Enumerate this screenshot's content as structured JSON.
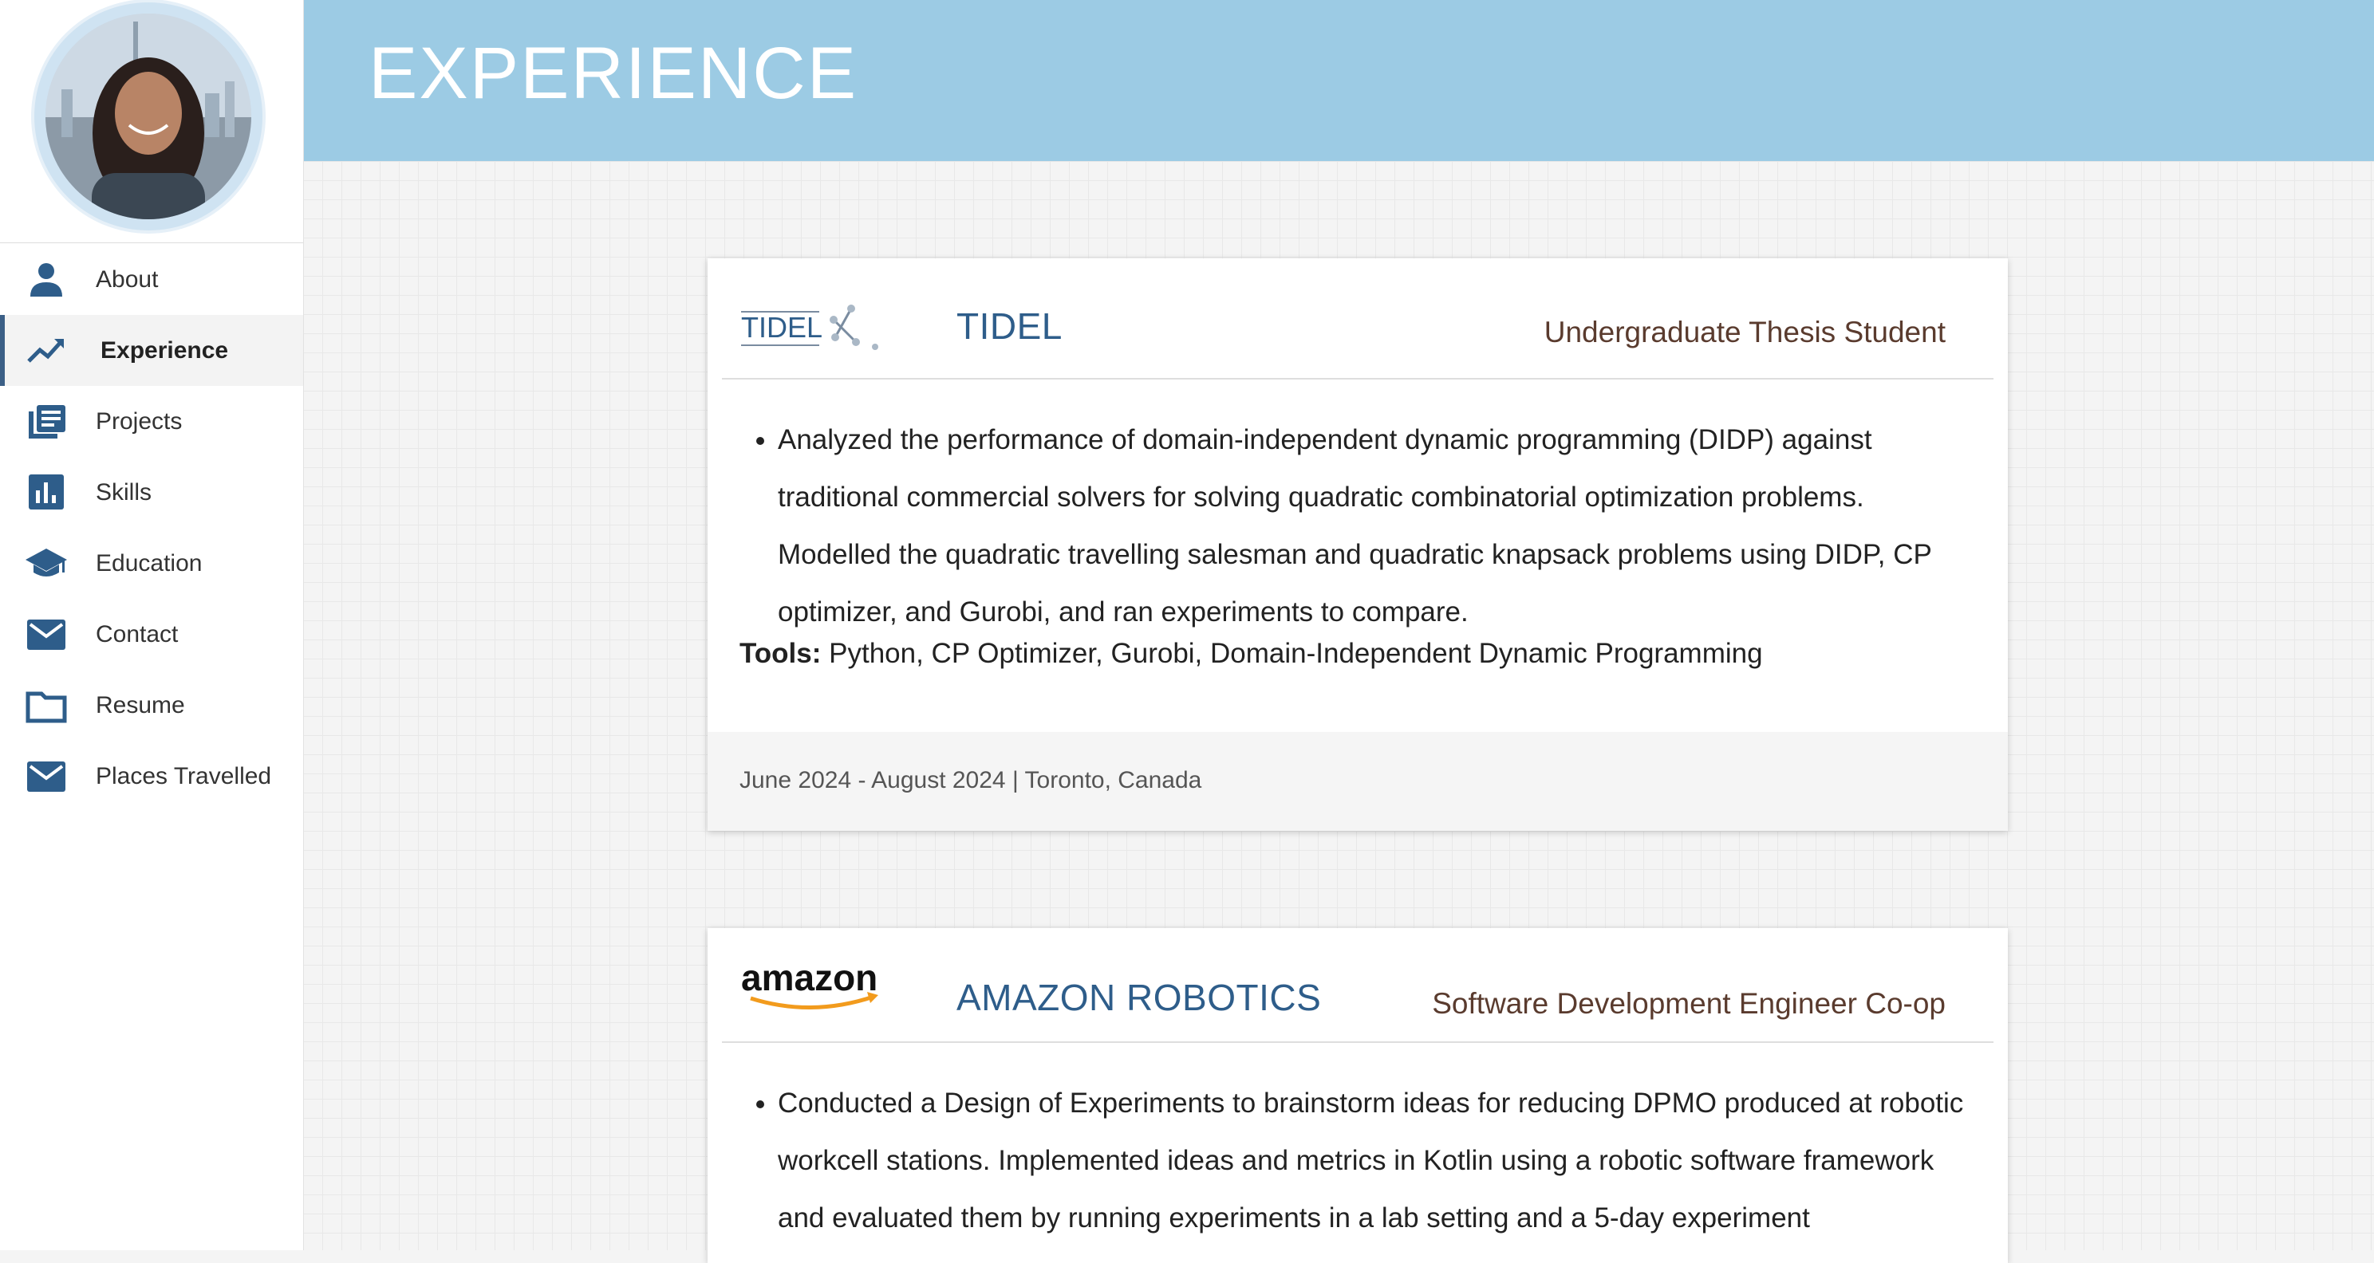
{
  "header": {
    "title": "EXPERIENCE"
  },
  "sidebar": {
    "items": [
      {
        "label": "About",
        "icon": "person-icon"
      },
      {
        "label": "Experience",
        "icon": "trending-up-icon",
        "active": true
      },
      {
        "label": "Projects",
        "icon": "library-books-icon"
      },
      {
        "label": "Skills",
        "icon": "bar-chart-icon"
      },
      {
        "label": "Education",
        "icon": "graduation-cap-icon"
      },
      {
        "label": "Contact",
        "icon": "mail-icon"
      },
      {
        "label": "Resume",
        "icon": "folder-icon"
      },
      {
        "label": "Places Travelled",
        "icon": "mail-icon"
      }
    ]
  },
  "experiences": [
    {
      "company": "TIDEL",
      "logo_text": "TIDEL",
      "role": "Undergraduate Thesis Student",
      "bullets": [
        "Analyzed the performance of domain-independent dynamic programming (DIDP) against traditional commercial solvers for solving quadratic combinatorial optimization problems. Modelled the quadratic travelling salesman and quadratic knapsack problems using DIDP, CP optimizer, and Gurobi, and ran experiments to compare."
      ],
      "tools_label": "Tools:",
      "tools": "Python, CP Optimizer, Gurobi, Domain-Independent Dynamic Programming",
      "footer": "June 2024 - August 2024 | Toronto, Canada"
    },
    {
      "company": "AMAZON ROBOTICS",
      "logo_text": "amazon",
      "role": "Software Development Engineer Co-op",
      "bullets": [
        "Conducted a Design of Experiments to brainstorm ideas for reducing DPMO produced at robotic workcell stations. Implemented ideas and metrics in Kotlin using a robotic software framework and evaluated them by running experiments in a lab setting and a 5-day experiment"
      ]
    }
  ],
  "colors": {
    "header_bg": "#9ccbe4",
    "nav_icon": "#2e5d8a",
    "company": "#2e5d8a",
    "role": "#5a3b2e"
  }
}
